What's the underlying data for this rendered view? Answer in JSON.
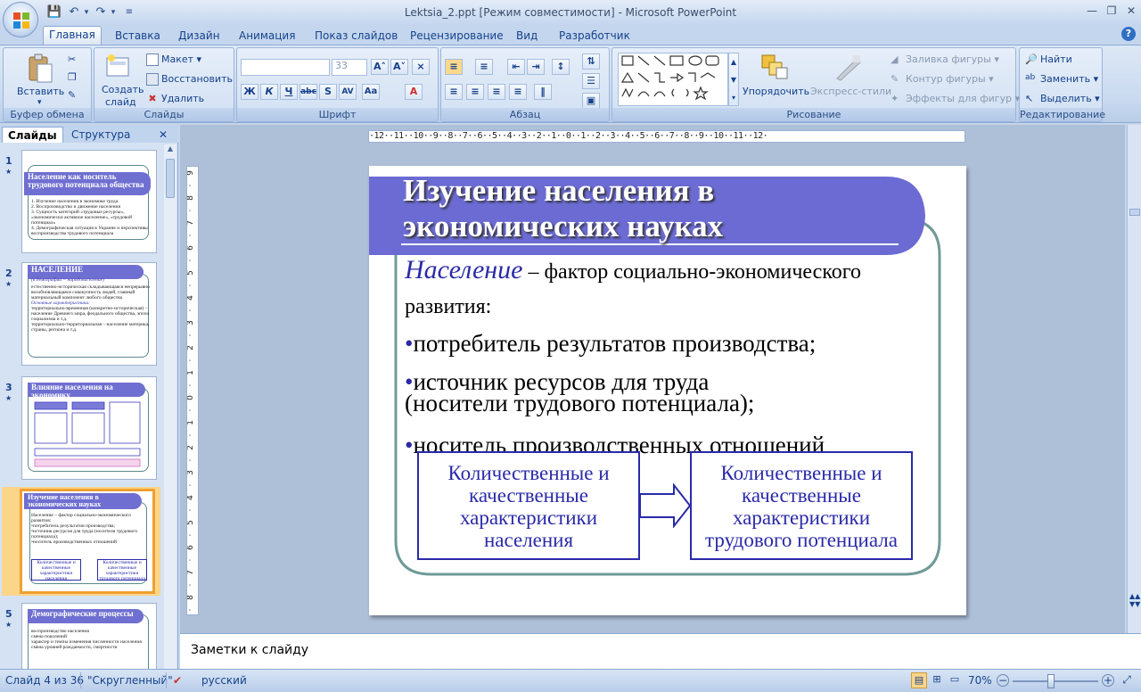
{
  "window": {
    "title": "Lektsia_2.ppt [Режим совместимости] - Microsoft PowerPoint"
  },
  "quick_access": [
    "save-icon",
    "undo-icon",
    "redo-icon",
    "customize-icon"
  ],
  "tabs": [
    {
      "label": "Главная",
      "active": true
    },
    {
      "label": "Вставка"
    },
    {
      "label": "Дизайн"
    },
    {
      "label": "Анимация"
    },
    {
      "label": "Показ слайдов"
    },
    {
      "label": "Рецензирование"
    },
    {
      "label": "Вид"
    },
    {
      "label": "Разработчик"
    }
  ],
  "ribbon": {
    "clipboard": {
      "label": "Буфер обмена",
      "paste": "Вставить"
    },
    "slides": {
      "label": "Слайды",
      "create_1": "Создать",
      "create_2": "слайд",
      "layout": "Макет",
      "reset": "Восстановить",
      "delete": "Удалить"
    },
    "font": {
      "label": "Шрифт",
      "size": "33"
    },
    "paragraph": {
      "label": "Абзац"
    },
    "drawing": {
      "label": "Рисование",
      "arrange": "Упорядочить",
      "quick_styles": "Экспресс-стили",
      "fill": "Заливка фигуры",
      "outline": "Контур фигуры",
      "effects": "Эффекты для фигур"
    },
    "editing": {
      "label": "Редактирование",
      "find": "Найти",
      "replace": "Заменить",
      "select": "Выделить"
    }
  },
  "left_pane": {
    "tab_slides": "Слайды",
    "tab_outline": "Структура",
    "thumbs": [
      {
        "num": "1",
        "title": "Население как носитель трудового потенциала общества",
        "lines": [
          "1. Изучение населения в экономике труда",
          "2. Воспроизводство и движение населения",
          "3. Сущность категорий «трудовые ресурсы», «экономически активное население», «трудовой потенциал»",
          "4. Демографическая ситуация в Украине и перспективы воспроизводства трудового потенциала"
        ]
      },
      {
        "num": "2",
        "title": "НАСЕЛЕНИЕ",
        "subtitle": "(в демографии = народонаселение)",
        "lines": [
          "естественно-историческая складывающаяся непрерывно возобновляющаяся совокупность людей, главный материальный компонент любого общества",
          "Основные характеристики:",
          "территориально-временная (конкретно-историческая) – население Древнего мира, феодального общества, эпохи социализма и т.д.",
          "территориально-территориальная – население материка, страны, региона и т.д."
        ]
      },
      {
        "num": "3",
        "title": "Влияние населения на экономику"
      },
      {
        "num": "4",
        "title": "Изучение населения в экономических науках",
        "lines": [
          "Население – фактор социально-экономического развития:",
          "•потребитель результатов производства;",
          "•источник ресурсов для труда (носители трудового потенциала);",
          "•носитель производственных отношений"
        ]
      },
      {
        "num": "5",
        "title": "Демографические процессы",
        "lines": [
          "воспроизводство населения",
          "смена поколений",
          "характер и темпы изменения численности населения",
          "смена уровней рождаемости, смертности"
        ]
      }
    ]
  },
  "slide": {
    "title_line1": "Изучение населения в",
    "title_line2": "экономических науках",
    "intro_term": "Население",
    "intro_rest": " – фактор социально-экономического",
    "intro_line2": "развития:",
    "bullet_1": "потребитель результатов производства;",
    "bullet_2a": "источник ресурсов для труда",
    "bullet_2b": "(носители трудового потенциала);",
    "bullet_3": "носитель производственных отношений",
    "box_left": "Количественные и качественные характеристики населения",
    "box_right": "Количественные и качественные характеристики трудового потенциала"
  },
  "notes": {
    "placeholder": "Заметки к слайду"
  },
  "status": {
    "slide_of": "Слайд 4 из 36",
    "theme": "\"Скругленный\"",
    "language": "русский",
    "zoom": "70%",
    "zoom_fraction": 0.45
  },
  "colors": {
    "accent": "#6b6bd3",
    "frame": "#5b8a8a",
    "boxes": "#2a2aa8"
  }
}
